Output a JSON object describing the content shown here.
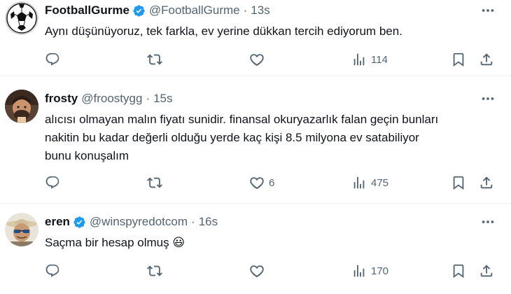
{
  "tweets": [
    {
      "name": "FootballGurme",
      "handle": "@FootballGurme",
      "separator": "·",
      "time": "13s",
      "avatar_icon": "soccer-ball-icon",
      "lines": [
        "Aynı düşünüyoruz, tek farkla, ev yerine dükkan tercih ediyorum ben."
      ],
      "likes": "",
      "views": "114"
    },
    {
      "name": "frosty",
      "handle": "@froostygg",
      "separator": "·",
      "time": "15s",
      "avatar_icon": "man-photo-avatar",
      "lines": [
        "alıcısı olmayan malın fiyatı sunidir. finansal okuryazarlık falan geçin bunları",
        "nakitin bu kadar değerli olduğu yerde kaç kişi 8.5 milyona ev satabiliyor",
        "bunu konuşalım"
      ],
      "likes": "6",
      "views": "475"
    },
    {
      "name": "eren",
      "handle": "@winspyredotcom",
      "separator": "·",
      "time": "16s",
      "avatar_icon": "man-with-hat-avatar",
      "lines": [
        "Saçma bir hesap olmuş 😃"
      ],
      "likes": "",
      "views": "170"
    }
  ],
  "colors": {
    "verified": "#1d9bf0",
    "muted": "#536471",
    "text": "#0f1419",
    "divider": "#eff3f4"
  }
}
